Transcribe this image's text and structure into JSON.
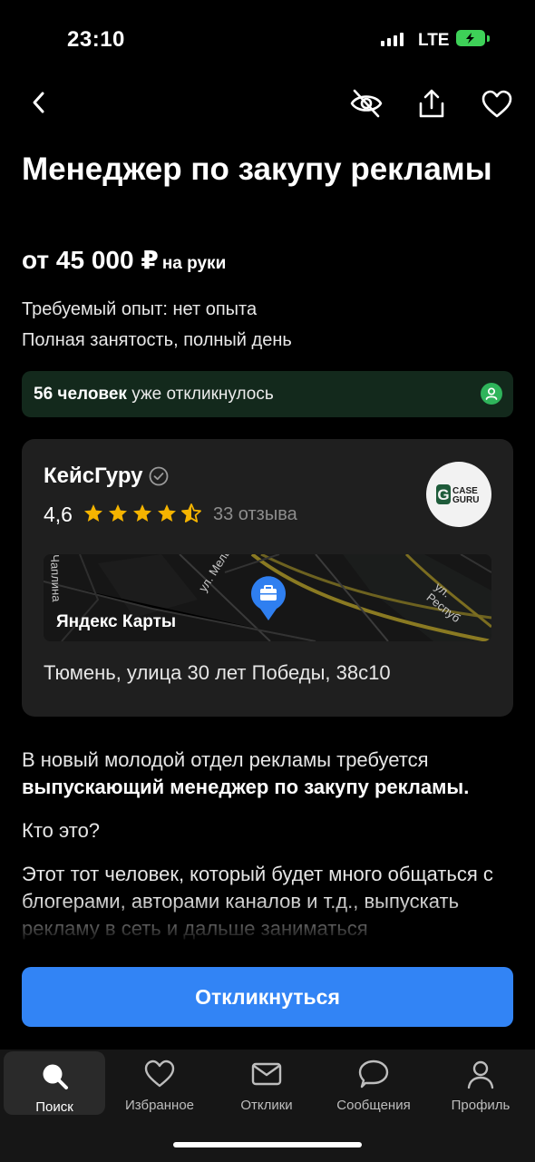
{
  "status": {
    "time": "23:10",
    "network": "LTE"
  },
  "nav": {
    "back_icon": "chevron-left-icon",
    "hide_icon": "eye-slash-icon",
    "share_icon": "share-icon",
    "favorite_icon": "heart-icon"
  },
  "vacancy": {
    "title": "Менеджер по закупу рекламы",
    "salary": "от 45 000 ₽",
    "salary_suffix": "на руки",
    "experience": "Требуемый опыт: нет опыта",
    "employment": "Полная занятость, полный день"
  },
  "responses": {
    "count": "56 человек",
    "text": "уже откликнулось"
  },
  "company": {
    "name": "КейсГуру",
    "rating": "4,6",
    "stars": 4.5,
    "reviews": "33 отзыва",
    "logo_text_top": "CASE",
    "logo_text_bottom": "GURU",
    "logo_letter": "G",
    "map_label": "Яндекс Карты",
    "street_1": "ул. Мельн",
    "street_2": "ул. Респуб",
    "street_3": "Чаплина",
    "address": "Тюмень, улица 30 лет Победы, 38с10"
  },
  "description": {
    "p1_normal": "В новый молодой отдел рекламы требуется",
    "p1_bold": "выпускающий менеджер по закупу рекламы.",
    "p2": "Кто это?",
    "p3": "Этот тот человек, который будет много общаться с блогерами, авторами каналов и т.д., выпускать рекламу в сеть и дальше заниматься"
  },
  "apply_button": "Откликнуться",
  "tabs": [
    {
      "label": "Поиск",
      "icon": "search-icon",
      "active": true
    },
    {
      "label": "Избранное",
      "icon": "heart-icon"
    },
    {
      "label": "Отклики",
      "icon": "mail-icon"
    },
    {
      "label": "Сообщения",
      "icon": "chat-icon"
    },
    {
      "label": "Профиль",
      "icon": "person-icon"
    }
  ],
  "colors": {
    "accent": "#3284f5",
    "star": "#f5b400",
    "success": "#2fb45b",
    "battery": "#3ed158"
  }
}
